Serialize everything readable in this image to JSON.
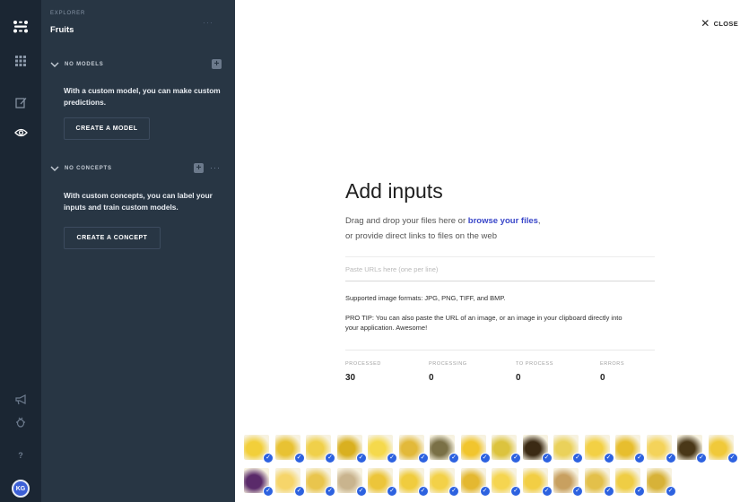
{
  "app": {
    "caption": "EXPLORER",
    "name": "Fruits",
    "menu_label": "···"
  },
  "models": {
    "header": "NO MODELS",
    "add_label": "+",
    "message": "With a custom model, you can make custom predictions.",
    "button": "CREATE A MODEL"
  },
  "concepts": {
    "header": "NO CONCEPTS",
    "add_label": "+",
    "more_label": "···",
    "message": "With custom concepts, you can label your inputs and train custom models.",
    "button": "CREATE A CONCEPT"
  },
  "rail": {
    "icons": [
      "logo-icon",
      "apps-grid-icon",
      "edit-icon",
      "eye-icon",
      "megaphone-icon",
      "bug-icon",
      "help-icon"
    ],
    "help_label": "?",
    "avatar": "KG"
  },
  "main": {
    "close_label": "CLOSE",
    "title": "Add inputs",
    "desc_prefix": "Drag and drop your files here or ",
    "desc_link": "browse your files",
    "desc_suffix": ",",
    "desc_line2": "or provide direct links to files on the web",
    "url_placeholder": "Paste URLs here (one per line)",
    "formats_note": "Supported image formats: JPG, PNG, TIFF, and BMP.",
    "pro_tip": "PRO TIP: You can also paste the URL of an image, or an image in your clipboard directly into your application. Awesome!",
    "stats": [
      {
        "label": "PROCESSED",
        "value": "30"
      },
      {
        "label": "PROCESSING",
        "value": "0"
      },
      {
        "label": "TO PROCESS",
        "value": "0"
      },
      {
        "label": "ERRORS",
        "value": "0"
      }
    ]
  },
  "thumbnails": {
    "count": 30,
    "colors": [
      "#f2cf3a",
      "#e8c233",
      "#f0d04a",
      "#d9b020",
      "#f5d94c",
      "#e2b93a",
      "#7a7046",
      "#f1c52e",
      "#dcc33e",
      "#3b2a14",
      "#ead15a",
      "#f3d044",
      "#e7be2e",
      "#f4d35a",
      "#4a3818",
      "#f0c93a",
      "#5a2a6a",
      "#f6d56a",
      "#e9c54d",
      "#c9b48e",
      "#ecc53a",
      "#f0cc3e",
      "#f3d148",
      "#e4b831",
      "#f5d550",
      "#f2ce44",
      "#c8a060",
      "#e3c04a",
      "#efcd44",
      "#d7b238"
    ]
  }
}
